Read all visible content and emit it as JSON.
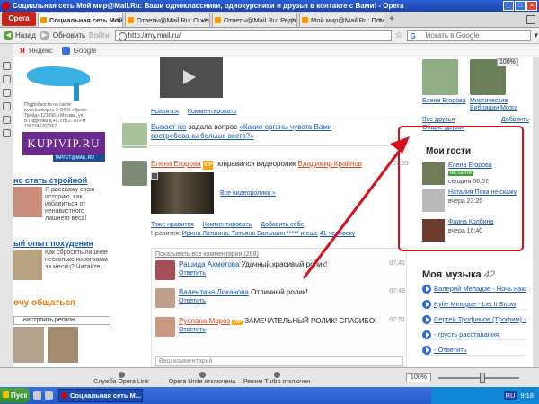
{
  "window": {
    "title": "Социальная сеть Мой мир@Mail.Ru: Ваши одноклассники, однокурсники и друзья в контакте с Вами! - Opera",
    "buttons": [
      "_",
      "□",
      "×"
    ]
  },
  "tabs": {
    "menu_label": "Opera",
    "items": [
      {
        "label": "Социальная сеть Мой м...",
        "active": true
      },
      {
        "label": "Ответы@Mail.Ru: О жен...",
        "active": false
      },
      {
        "label": "Ответы@Mail.Ru: Редак...",
        "active": false
      },
      {
        "label": "Мой мир@Mail.Ru: Пом...",
        "active": false
      }
    ],
    "new_tab": "+"
  },
  "nav": {
    "back": "Назад",
    "forward": "Вперед",
    "reload": "Обновить",
    "login": "Войти",
    "url": "http://my.mail.ru/",
    "search_placeholder": "Искать в Google"
  },
  "bookmarks": [
    {
      "label": "Яндекс",
      "icon": "yandex-icon"
    },
    {
      "label": "Google",
      "icon": "google-icon"
    }
  ],
  "zoom_tag": "100%",
  "ads": {
    "shoe_caption": "Подробности на сайте www.kupivip.ru\n© ООО «Триал Трейд» 121096, г.Москва, ул. В.Годунова д.4а, стр.2. ОГРН 1087746762367",
    "kupivip": "KUPIVIP.RU",
    "target": "TAPГЕТ@MAIL.RU",
    "slim_title": "нс стать стройной",
    "slim_text": "Я расскажу свою историю, как избавиться от ненавистного лишнего веса!",
    "experience_title": "ый опыт похудения",
    "experience_text": "Как сбросить лишние несколько килограмм за месяц? Читайте.",
    "chat_title": "очу общаться",
    "settings_link": "настроить регион"
  },
  "feed": {
    "like_top": "Нравится",
    "comment_top": "Комментировать",
    "question_prefix": "Бывает же",
    "question_action": "задала вопрос",
    "question_text": "«Какие органы чувств Вами востребованы больше всего?»",
    "author": "Елена Егорова",
    "vip": "VIP",
    "action": "понравился видеоролик",
    "video_author": "Владимир Крайнов",
    "time": "07:55",
    "all_videos": "Все видеоролики »",
    "actions": [
      "Тоже нравится",
      "Комментировать",
      "Добавить себе"
    ],
    "likes_label": "Нравится:",
    "likes_names": "Ирина Латшина, Татьяна Балышин ***** и еще",
    "likes_more": "41 человеку",
    "show_all": "Показывать все комментарии (268)",
    "comments": [
      {
        "name": "Рашида Ахметова",
        "text": "Удачный,красивый ролик!",
        "reply": "Ответить",
        "time": "07:41",
        "vip": ""
      },
      {
        "name": "Валентина Ликанова",
        "text": "Отличный ролик!",
        "reply": "Ответить",
        "time": "07:43",
        "vip": ""
      },
      {
        "name": "Руслана Мороз",
        "text": "ЗАМЕЧАТЕЛЬНЫЙ РОЛИК! СПАСИБО!",
        "reply": "Ответить",
        "time": "07:51",
        "vip": "VIP"
      }
    ],
    "comment_placeholder": "Ваш комментарий"
  },
  "right": {
    "friends": [
      {
        "name": "Елена Егорова"
      },
      {
        "name": "Мистические Вибрации Мозга"
      }
    ],
    "all_friends": "Все друзья",
    "add": "Добавить",
    "other_friends": "Общие друзья",
    "guests_title": "Мои гости",
    "guests": [
      {
        "name": "Елена Егорова",
        "status": "на сайте",
        "time": "сегодня 06:57"
      },
      {
        "name": "Наталия Пока не скажу",
        "status": "",
        "time": "вчера 23:25"
      },
      {
        "name": "Фаина Колбина",
        "status": "",
        "time": "вчера 16:40"
      }
    ],
    "music_title": "Моя музыка",
    "music_count": "42",
    "tracks": [
      "Валерий Меладзе - Ночь накануне",
      "Kylie Minogue - Let It Snow",
      "Сергей Трофимов (Трофим) - ...",
      "- грусть расставания",
      "- Ответить"
    ]
  },
  "status": {
    "link": "Служба Opera Link отключена",
    "unite": "Opera Unite отключена",
    "turbo": "Режим Turbo отключен",
    "zoom": "100%"
  },
  "taskbar": {
    "start": "Пуск",
    "task": "Социальная сеть М...",
    "lang": "RU",
    "clock": "9:18"
  }
}
